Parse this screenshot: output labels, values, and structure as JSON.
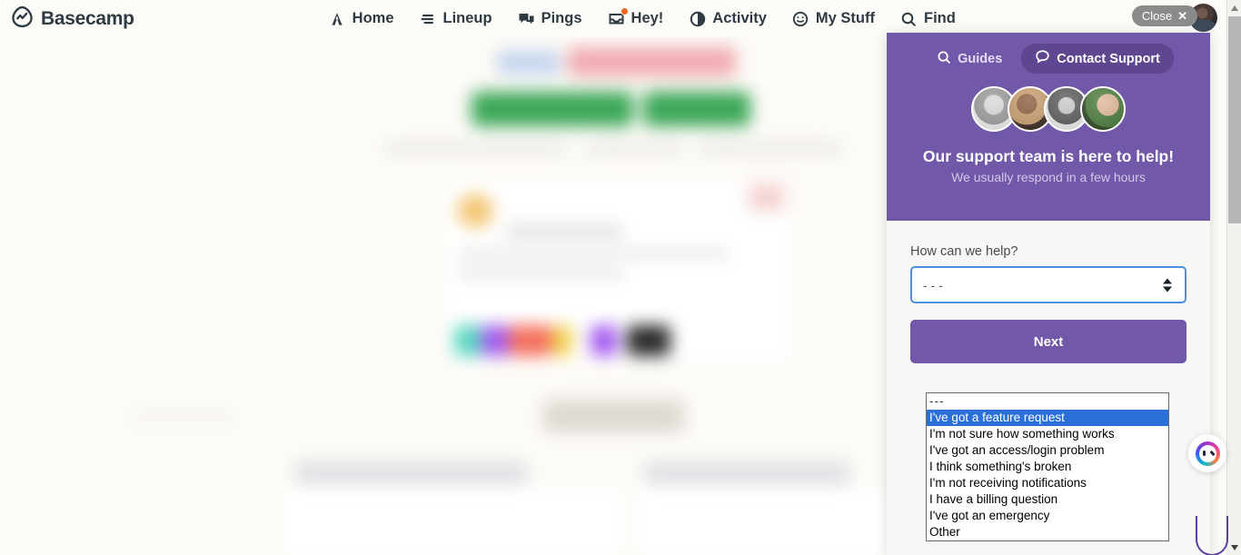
{
  "app": {
    "brand": "Basecamp",
    "brand_logo_icon": "basecamp-logo-icon"
  },
  "topnav": {
    "items": [
      {
        "label": "Home",
        "icon": "home-tent-icon"
      },
      {
        "label": "Lineup",
        "icon": "lineup-bars-icon"
      },
      {
        "label": "Pings",
        "icon": "chat-bubbles-icon"
      },
      {
        "label": "Hey!",
        "icon": "inbox-tray-icon",
        "badge": true
      },
      {
        "label": "Activity",
        "icon": "half-circle-icon"
      },
      {
        "label": "My Stuff",
        "icon": "smiley-face-icon"
      },
      {
        "label": "Find",
        "icon": "search-magnifier-icon"
      }
    ],
    "find_tail_visible_text": "nd",
    "close_label": "Close",
    "close_icon": "close-x-icon",
    "avatar_icon": "user-avatar"
  },
  "support_panel": {
    "tabs": [
      {
        "label": "Guides",
        "icon": "search-magnifier-icon",
        "active": false
      },
      {
        "label": "Contact Support",
        "icon": "speech-bubble-icon",
        "active": true
      }
    ],
    "avatars": [
      "support-agent-avatar-1",
      "support-agent-avatar-2",
      "support-agent-avatar-3",
      "support-agent-avatar-4"
    ],
    "headline": "Our support team is here to help!",
    "subhead": "We usually respond in a few hours",
    "form": {
      "field_label": "How can we help?",
      "select_value": "- - -",
      "select_icon": "updown-spinner-icon",
      "next_label": "Next"
    },
    "dropdown": {
      "open": true,
      "selected_index": 1,
      "options": [
        "---",
        "I've got a feature request",
        "I'm not sure how something works",
        "I've got an access/login problem",
        "I think something's broken",
        "I'm not receiving notifications",
        "I have a billing question",
        "I've got an emergency",
        "Other"
      ]
    }
  },
  "assistant": {
    "launcher_icon": "assistant-orb-icon"
  },
  "scrollbar": {
    "up_icon": "scroll-up-arrow-icon",
    "down_icon": "scroll-down-arrow-icon"
  },
  "colors": {
    "brand_ink": "#2e3b44",
    "panel_purple": "#7258a8",
    "tab_active_purple": "#5f4691",
    "focus_blue": "#4a90e2",
    "option_highlight": "#2a70d8",
    "page_bg": "#fdfbf7",
    "badge_orange": "#f3641f"
  }
}
